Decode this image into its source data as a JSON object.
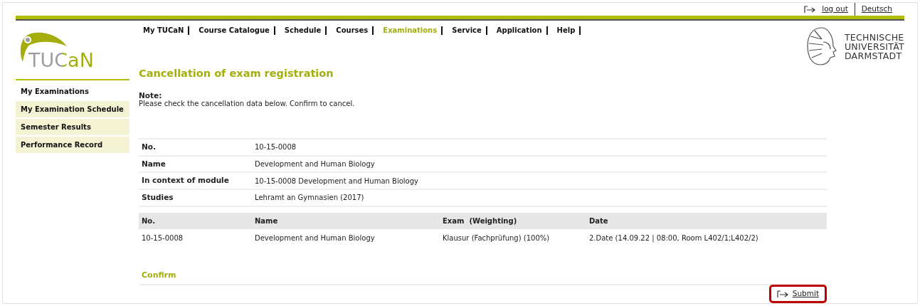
{
  "top_links": [
    {
      "kind": "logout",
      "label": "log out"
    },
    {
      "kind": "language",
      "label": "Deutsch"
    }
  ],
  "logo": {
    "text": "TUCaN"
  },
  "university": {
    "lines": [
      "TECHNISCHE",
      "UNIVERSITÄT",
      "DARMSTADT"
    ]
  },
  "nav": [
    {
      "label": "My TUCaN",
      "selected": false
    },
    {
      "label": "Course Catalogue",
      "selected": false
    },
    {
      "label": "Schedule",
      "selected": false
    },
    {
      "label": "Courses",
      "selected": false
    },
    {
      "label": "Examinations",
      "selected": true
    },
    {
      "label": "Service",
      "selected": false
    },
    {
      "label": "Application",
      "selected": false
    },
    {
      "label": "Help",
      "selected": false
    }
  ],
  "sidebar": {
    "items": [
      {
        "label": "My Examinations",
        "selected": true
      },
      {
        "label": "My Examination Schedule",
        "selected": false
      },
      {
        "label": "Semester Results",
        "selected": false
      },
      {
        "label": "Performance Record",
        "selected": false
      }
    ]
  },
  "page_title": "Cancellation of exam registration",
  "note": {
    "label": "Note:",
    "text": "Please check the cancellation data below. Confirm to cancel."
  },
  "details": [
    {
      "label": "No.",
      "value": "10-15-0008"
    },
    {
      "label": "Name",
      "value": "Development and Human Biology"
    },
    {
      "label": "In context of module",
      "value": "10-15-0008 Development and Human Biology"
    },
    {
      "label": "Studies",
      "value": "Lehramt an Gymnasien (2017)"
    }
  ],
  "table": {
    "columns": [
      "No.",
      "Name",
      "Exam  (Weighting)",
      "Date"
    ],
    "rows": [
      [
        "10-15-0008",
        "Development and Human Biology",
        "Klausur (Fachprüfung) (100%)",
        "2.Date (14.09.22 | 08:00, Room L402/1;L402/2)"
      ]
    ]
  },
  "confirm": {
    "heading": "Confirm",
    "button": {
      "label": "Submit",
      "highlighted": true
    }
  }
}
